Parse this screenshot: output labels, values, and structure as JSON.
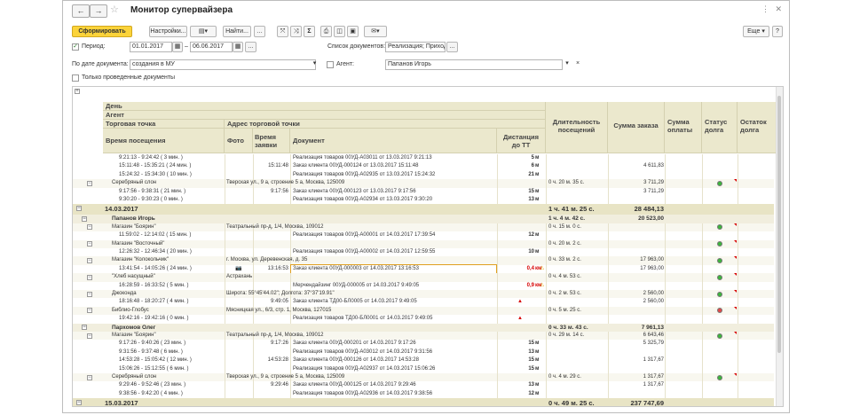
{
  "window": {
    "title": "Монитор супервайзера",
    "more_label": "Еще",
    "help_label": "?"
  },
  "toolbar": {
    "generate": "Сформировать",
    "settings": "Настройки...",
    "find": "Найти...",
    "sigma": "Σ"
  },
  "filters": {
    "period_label": "Период:",
    "date_from": "01.01.2017",
    "date_sep": "–",
    "date_to": "06.06.2017",
    "dots": "...",
    "doc_list_label": "Список документов:",
    "doc_list_value": "Реализация; Приходны",
    "by_doc_date_label": "По дате документа:",
    "by_doc_date_value": "создания в МУ",
    "agent_label": "Агент:",
    "agent_value": "Папанов Игорь",
    "only_posted_label": "Только проведенные документы"
  },
  "headers": {
    "day": "День",
    "agent": "Агент",
    "outlet": "Торговая точка",
    "outlet_address": "Адрес торговой точки",
    "visit_time": "Время посещения",
    "photo": "Фото",
    "order_time": "Время заявки",
    "document": "Документ",
    "distance": "Дистанция до ТТ",
    "visit_duration": "Длительность посещений",
    "order_sum": "Сумма заказа",
    "paid_sum": "Сумма оплаты",
    "debt_status": "Статус долга",
    "debt_balance": "Остаток долга"
  },
  "rows": [
    {
      "kind": "visit",
      "time": "9:21:13 - 9:24:42 ( 3 мин. )",
      "order_time": "",
      "doc": "Реализация товаров 00УД-А03011 от 13.03.2017 9:21:13",
      "dist": "5",
      "unit": "м",
      "dur": "",
      "sum": ""
    },
    {
      "kind": "visit",
      "time": "15:11:48 - 15:35:21 ( 24 мин. )",
      "order_time": "15:11:48",
      "doc": "Заказ клиента 00УД-000124 от 13.03.2017 15:11:48",
      "dist": "6",
      "unit": "м",
      "dur": "",
      "sum": "4 611,83"
    },
    {
      "kind": "visit",
      "time": "15:24:32 - 15:34:30 ( 10 мин. )",
      "order_time": "",
      "doc": "Реализация товаров 00УД-А02935 от 13.03.2017 15:24:32",
      "dist": "21",
      "unit": "м",
      "dur": "",
      "sum": ""
    },
    {
      "kind": "tt",
      "name": "Серебряный слон",
      "addr": "Тверская ул., 9 а, строение 5 а, Москва, 125009",
      "dur": "0 ч. 20 м. 35 с.",
      "sum": "3 711,29",
      "status": "green"
    },
    {
      "kind": "visit",
      "time": "9:17:56 - 9:38:31 ( 21 мин. )",
      "order_time": "9:17:56",
      "doc": "Заказ клиента 00УД-000123 от 13.03.2017 9:17:56",
      "dist": "15",
      "unit": "м",
      "dur": "",
      "sum": "3 711,29"
    },
    {
      "kind": "visit",
      "time": "9:30:20 - 9:30:23 ( 0 мин. )",
      "order_time": "",
      "doc": "Реализация товаров 00УД-А02934 от 13.03.2017 9:30:20",
      "dist": "13",
      "unit": "м",
      "dur": "",
      "sum": ""
    },
    {
      "kind": "day",
      "name": "14.03.2017",
      "dur": "1 ч. 41 м. 25 с.",
      "sum": "28 484,13"
    },
    {
      "kind": "agent",
      "name": "Папанов Игорь",
      "dur": "1 ч. 4 м. 42 с.",
      "sum": "20 523,00"
    },
    {
      "kind": "tt",
      "name": "Магазин \"Боярин\"",
      "addr": "Театральный пр-д, 1/4, Москва, 109012",
      "dur": "0 ч. 15 м. 0 с.",
      "sum": "",
      "status": "green"
    },
    {
      "kind": "visit",
      "time": "11:59:02 - 12:14:02 ( 15 мин. )",
      "order_time": "",
      "doc": "Реализация товаров 00УД-А00001 от 14.03.2017 17:39:54",
      "dist": "12",
      "unit": "м",
      "dur": "",
      "sum": ""
    },
    {
      "kind": "tt",
      "name": "Магазин \"Восточный\"",
      "addr": "",
      "dur": "0 ч. 20 м. 2 с.",
      "sum": "",
      "status": "green"
    },
    {
      "kind": "visit",
      "time": "12:26:32 - 12:46:34 ( 20 мин. )",
      "order_time": "",
      "doc": "Реализация товаров 00УД-А00002 от 14.03.2017 12:59:55",
      "dist": "10",
      "unit": "м",
      "dur": "",
      "sum": ""
    },
    {
      "kind": "tt",
      "name": "Магазин \"Колокольчик\"",
      "addr": "г. Москва, ул. Деревенская, д. 35",
      "dur": "0 ч. 33 м. 2 с.",
      "sum": "17 963,00",
      "status": "green"
    },
    {
      "kind": "visit",
      "time": "13:41:54 - 14:05:26 ( 24 мин. )",
      "photo": true,
      "order_time": "13:16:53",
      "doc": "Заказ клиента 00УД-000003 от 14.03.2017 13:16:53",
      "dist": "0,4",
      "unit": "км",
      "warn": true,
      "dur": "",
      "sum": "17 963,00"
    },
    {
      "kind": "tt",
      "name": "\"Хлеб насущный\"",
      "addr": "Астрахань",
      "dur": "0 ч. 4 м. 53 с.",
      "sum": "",
      "status": "green"
    },
    {
      "kind": "visit",
      "time": "16:28:59 - 16:33:52 ( 5 мин. )",
      "order_time": "",
      "doc": "Мерчендайзинг 00УД-000005 от 14.03.2017 9:49:05",
      "dist": "0,9",
      "unit": "км",
      "warn": true,
      "dur": "",
      "sum": ""
    },
    {
      "kind": "tt",
      "name": "Джоконда",
      "addr": "Широта: 55°45'44.02\"; Долгота: 37°37'19.91\"",
      "dur": "0 ч. 2 м. 53 с.",
      "sum": "2 560,00",
      "status": "green"
    },
    {
      "kind": "visit",
      "time": "18:16:48 - 18:20:27 ( 4 мин. )",
      "order_time": "9:49:05",
      "doc": "Заказ клиента ТД00-БЛ0005 от 14.03.2017 9:49:05",
      "dist": "",
      "unit": "",
      "alert": true,
      "dur": "",
      "sum": "2 560,00"
    },
    {
      "kind": "tt",
      "name": "Библио-Глобус",
      "addr": "Мясницкая ул., 6/3, стр. 1, Москва, 127015",
      "dur": "0 ч. 5 м. 25 с.",
      "sum": "",
      "status": "red"
    },
    {
      "kind": "visit",
      "time": "19:42:16 - 19:42:16 ( 0 мин. )",
      "order_time": "",
      "doc": "Реализация товаров ТД00-БЛ0001 от 14.03.2017 9:49:05",
      "dist": "",
      "unit": "",
      "alert": true,
      "dur": "",
      "sum": ""
    },
    {
      "kind": "agent",
      "name": "Пархомов Олег",
      "dur": "0 ч. 33 м. 43 с.",
      "sum": "7 961,13"
    },
    {
      "kind": "tt",
      "name": "Магазин \"Боярин\"",
      "addr": "Театральный пр-д, 1/4, Москва, 109012",
      "dur": "0 ч. 29 м. 14 с.",
      "sum": "6 643,46",
      "status": "green"
    },
    {
      "kind": "visit",
      "time": "9:17:26 - 9:40:26 ( 23 мин. )",
      "order_time": "9:17:26",
      "doc": "Заказ клиента 00УД-000201 от 14.03.2017 9:17:26",
      "dist": "15",
      "unit": "м",
      "dur": "",
      "sum": "5 325,79"
    },
    {
      "kind": "visit",
      "time": "9:31:56 - 9:37:48 ( 6 мин. )",
      "order_time": "",
      "doc": "Реализация товаров 00УД-А03012 от 14.03.2017 9:31:56",
      "dist": "13",
      "unit": "м",
      "dur": "",
      "sum": ""
    },
    {
      "kind": "visit",
      "time": "14:53:28 - 15:05:42 ( 12 мин. )",
      "order_time": "14:53:28",
      "doc": "Заказ клиента 00УД-000126 от 14.03.2017 14:53:28",
      "dist": "15",
      "unit": "м",
      "dur": "",
      "sum": "1 317,67"
    },
    {
      "kind": "visit",
      "time": "15:06:26 - 15:12:55 ( 6 мин. )",
      "order_time": "",
      "doc": "Реализация товаров 00УД-А02937 от 14.03.2017 15:06:26",
      "dist": "15",
      "unit": "м",
      "dur": "",
      "sum": ""
    },
    {
      "kind": "tt",
      "name": "Серебряный слон",
      "addr": "Тверская ул., 9 а, строение 5 а, Москва, 125009",
      "dur": "0 ч. 4 м. 29 с.",
      "sum": "1 317,67",
      "status": "green"
    },
    {
      "kind": "visit",
      "time": "9:29:46 - 9:52:46 ( 23 мин. )",
      "order_time": "9:29:46",
      "doc": "Заказ клиента 00УД-000125 от 14.03.2017 9:29:46",
      "dist": "13",
      "unit": "м",
      "dur": "",
      "sum": "1 317,67"
    },
    {
      "kind": "visit",
      "time": "9:38:56 - 9:42:20 ( 4 мин. )",
      "order_time": "",
      "doc": "Реализация товаров 00УД-А02936 от 14.03.2017 9:38:56",
      "dist": "12",
      "unit": "м",
      "dur": "",
      "sum": ""
    },
    {
      "kind": "day",
      "name": "15.03.2017",
      "dur": "0 ч. 49 м. 25 с.",
      "sum": "237 747,69"
    }
  ],
  "colors": {
    "accent": "#fbd33a",
    "header_bg": "#ebe8cd",
    "status_green": "#3cb43c",
    "status_red": "#e04848",
    "warn_red": "#d60000"
  }
}
